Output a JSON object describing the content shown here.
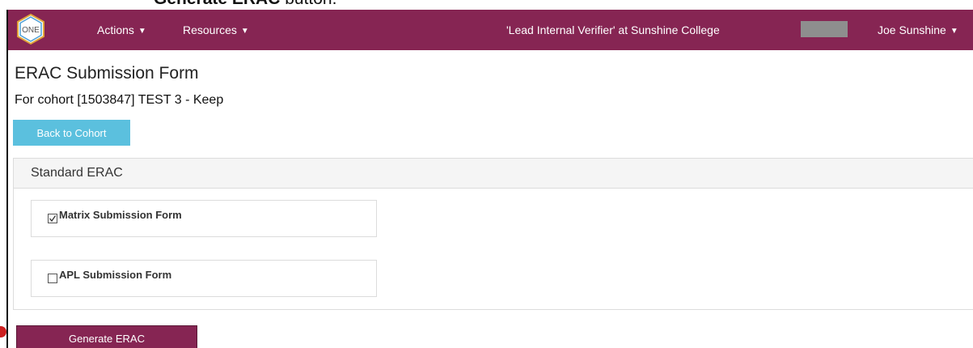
{
  "caption": {
    "bold": "Generate ERAC",
    "rest": " button."
  },
  "navbar": {
    "logo_text": "ONE",
    "actions_label": "Actions",
    "resources_label": "Resources",
    "role_text": "'Lead Internal Verifier' at Sunshine College",
    "user_name": "Joe Sunshine",
    "bg_color": "#862553"
  },
  "page": {
    "title": "ERAC Submission Form",
    "cohort_line": "For cohort [1503847] TEST 3 - Keep",
    "back_button": "Back to Cohort"
  },
  "panel": {
    "title": "Standard ERAC",
    "options": [
      {
        "label": "Matrix Submission Form",
        "checked": true
      },
      {
        "label": "APL Submission Form",
        "checked": false
      }
    ]
  },
  "generate_button": "Generate ERAC",
  "colors": {
    "accent": "#862553",
    "info": "#5bc0de"
  }
}
